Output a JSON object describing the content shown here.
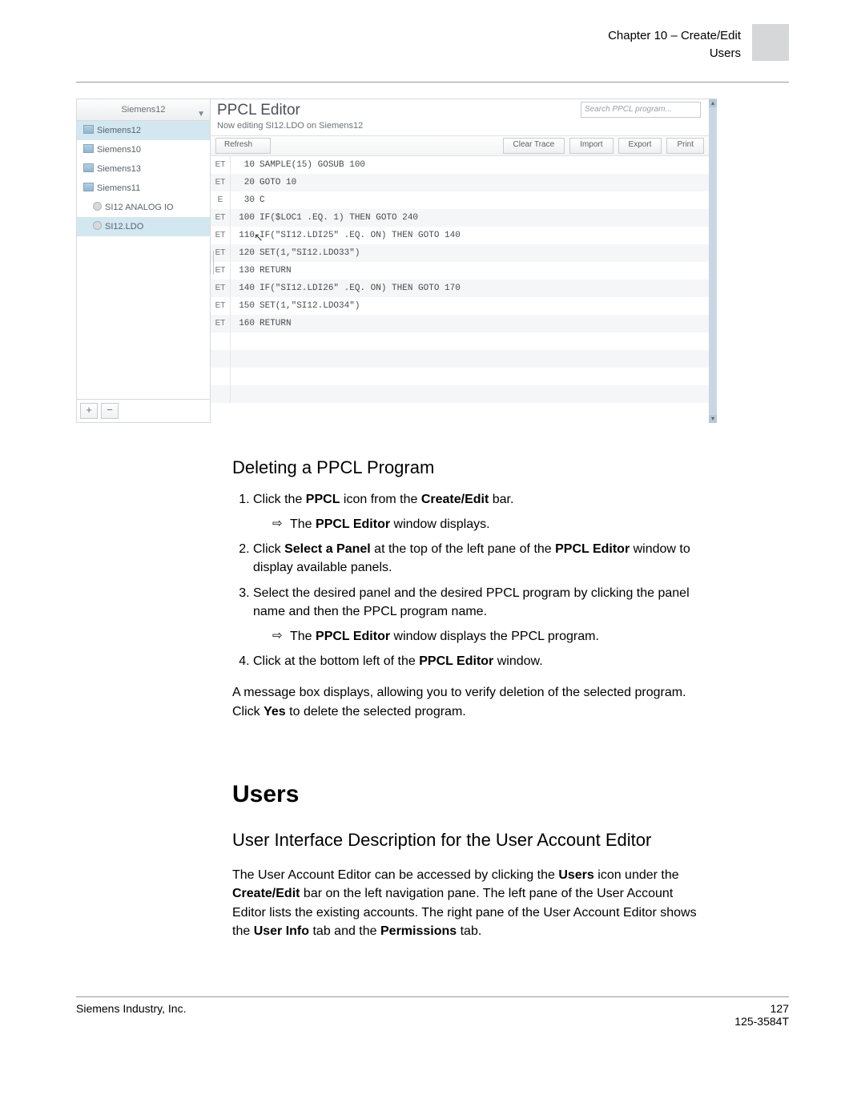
{
  "header": {
    "chapter": "Chapter 10 – Create/Edit",
    "section": "Users"
  },
  "shot": {
    "panel_select": "Siemens12",
    "tree": [
      {
        "label": "Siemens12",
        "icon": "panel",
        "lvl": 0,
        "sel": true
      },
      {
        "label": "Siemens10",
        "icon": "panel",
        "lvl": 0,
        "sel": false
      },
      {
        "label": "Siemens13",
        "icon": "panel",
        "lvl": 0,
        "sel": false
      },
      {
        "label": "Siemens11",
        "icon": "panel",
        "lvl": 0,
        "sel": false
      },
      {
        "label": "SI12 ANALOG IO",
        "icon": "point",
        "lvl": 1,
        "sel": false
      },
      {
        "label": "SI12.LDO",
        "icon": "point",
        "lvl": 1,
        "sel": true
      }
    ],
    "add_btn": "+",
    "del_btn": "−",
    "title": "PPCL Editor",
    "subtitle": "Now editing SI12.LDO on Siemens12",
    "search_placeholder": "Search PPCL program...",
    "toolbar": {
      "refresh": "Refresh",
      "clear_trace": "Clear Trace",
      "import": "Import",
      "export": "Export",
      "print": "Print"
    },
    "rows": [
      {
        "st": "ET",
        "ln": "10",
        "code": "SAMPLE(15) GOSUB 100"
      },
      {
        "st": "ET",
        "ln": "20",
        "code": "GOTO 10"
      },
      {
        "st": "E",
        "ln": "30",
        "code": "C"
      },
      {
        "st": "ET",
        "ln": "100",
        "code": "IF($LOC1 .EQ. 1) THEN GOTO 240"
      },
      {
        "st": "ET",
        "ln": "110",
        "code": "IF(\"SI12.LDI25\" .EQ. ON) THEN GOTO 140"
      },
      {
        "st": "ET",
        "ln": "120",
        "code": "SET(1,\"SI12.LDO33\")"
      },
      {
        "st": "ET",
        "ln": "130",
        "code": "RETURN"
      },
      {
        "st": "ET",
        "ln": "140",
        "code": "IF(\"SI12.LDI26\" .EQ. ON) THEN GOTO 170"
      },
      {
        "st": "ET",
        "ln": "150",
        "code": "SET(1,\"SI12.LDO34\")"
      },
      {
        "st": "ET",
        "ln": "160",
        "code": "RETURN"
      },
      {
        "st": "",
        "ln": "",
        "code": ""
      },
      {
        "st": "",
        "ln": "",
        "code": ""
      },
      {
        "st": "",
        "ln": "",
        "code": ""
      },
      {
        "st": "",
        "ln": "",
        "code": ""
      }
    ]
  },
  "doc": {
    "delete_heading": "Deleting a PPCL Program",
    "step1_a": "Click the ",
    "step1_b": "PPCL",
    "step1_c": " icon from the ",
    "step1_d": "Create/Edit",
    "step1_e": " bar.",
    "sub1_a": "The ",
    "sub1_b": "PPCL Editor",
    "sub1_c": " window displays.",
    "step2_a": "Click ",
    "step2_b": "Select a Panel",
    "step2_c": " at the top of the left pane of the ",
    "step2_d": "PPCL Editor",
    "step2_e": " window to display available panels.",
    "step3": "Select the desired panel and the desired PPCL program by clicking the panel name and then the PPCL program name.",
    "sub3_a": "The ",
    "sub3_b": "PPCL Editor",
    "sub3_c": " window displays the PPCL program.",
    "step4_a": "Click at the bottom left of the ",
    "step4_b": "PPCL Editor",
    "step4_c": " window.",
    "para_a": "A message box displays, allowing you to verify deletion of the selected program. Click ",
    "para_b": "Yes",
    "para_c": " to delete the selected program.",
    "h1": "Users",
    "h2b": "User Interface Description for the User Account Editor",
    "users_a": "The User Account Editor can be accessed by clicking the ",
    "users_b": "Users",
    "users_c": " icon under the ",
    "users_d": "Create/Edit",
    "users_e": " bar on the left navigation pane. The left pane of the User Account Editor lists the existing accounts. The right pane of the User Account Editor shows the ",
    "users_f": "User Info",
    "users_g": " tab and the ",
    "users_h": "Permissions",
    "users_i": " tab."
  },
  "footer": {
    "left": "Siemens Industry, Inc.",
    "page": "127",
    "docid": "125-3584T"
  }
}
